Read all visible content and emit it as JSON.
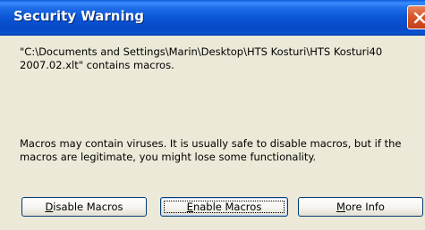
{
  "dialog": {
    "title": "Security Warning",
    "close_icon": "close-icon"
  },
  "message": {
    "line1": "\"C:\\Documents and Settings\\Marin\\Desktop\\HTS Kosturi\\HTS Kosturi40",
    "line2": "2007.02.xlt\" contains macros."
  },
  "warning": {
    "line1": "Macros may contain viruses. It is usually safe to disable macros, but if the",
    "line2": "macros are legitimate, you might lose some functionality."
  },
  "buttons": {
    "disable": {
      "mnemonic": "D",
      "rest": "isable Macros"
    },
    "enable": {
      "mnemonic": "E",
      "rest": "nable Macros"
    },
    "more_info": {
      "mnemonic": "M",
      "rest": "ore Info"
    }
  },
  "colors": {
    "titlebar": "#0a55d6",
    "dialog_bg": "#ece9d8",
    "close_button": "#d8562c",
    "button_border": "#003c74"
  }
}
